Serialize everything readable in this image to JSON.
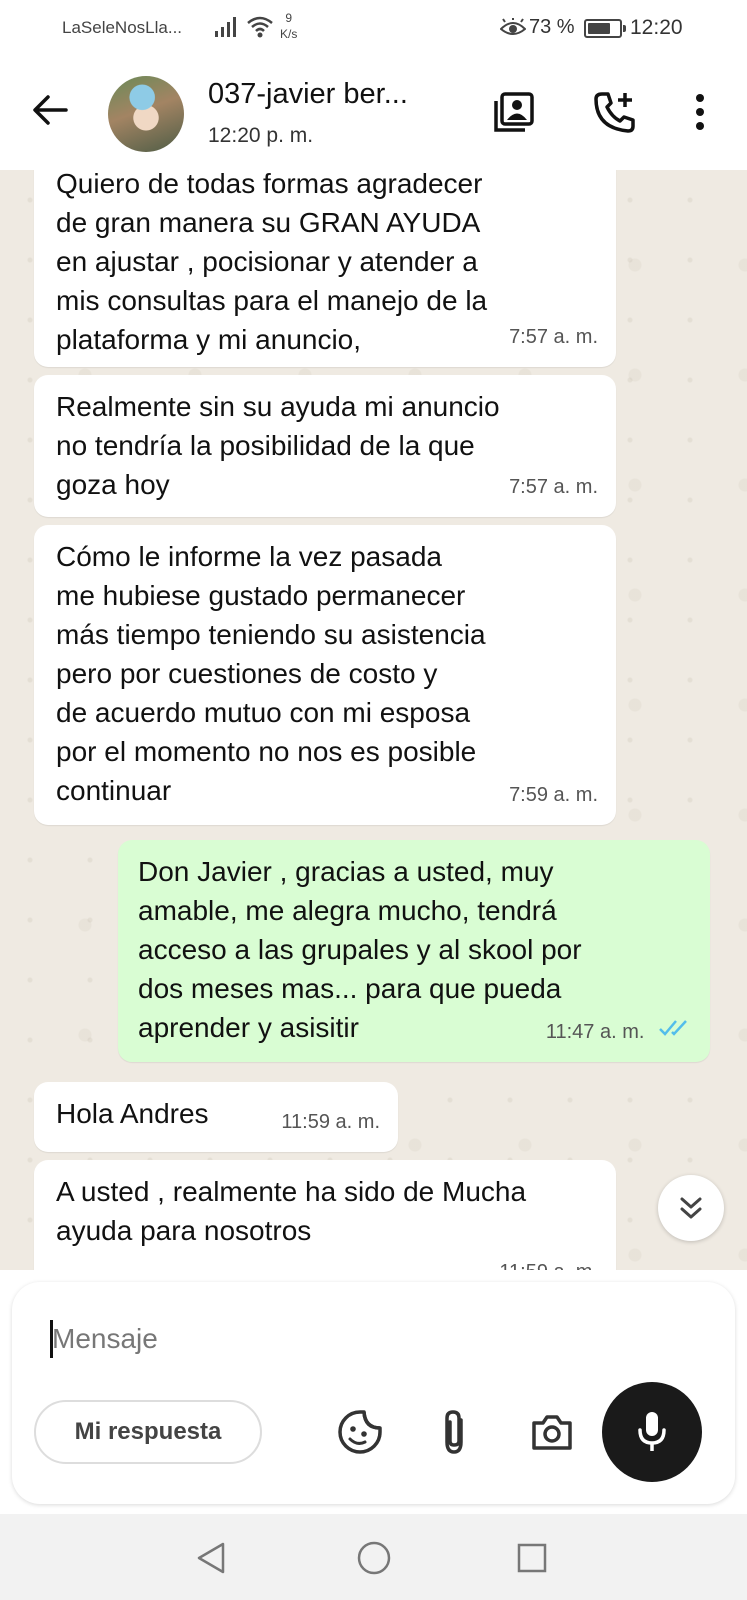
{
  "status_bar": {
    "carrier": "LaSeleNosLla...",
    "speed_value": "9",
    "speed_unit": "K/s",
    "battery_percent": "73 %",
    "battery_level": 0.73,
    "time": "12:20",
    "icons": [
      "signal-icon",
      "wifi-icon",
      "eye-comfort-icon",
      "battery-icon"
    ]
  },
  "header": {
    "title": "037-javier ber...",
    "subtitle": "12:20 p. m.",
    "icons": [
      "back-arrow-icon",
      "contact-card-icon",
      "add-call-icon",
      "more-vert-icon"
    ]
  },
  "messages": [
    {
      "direction": "in",
      "text": "Quiero de todas formas agradecer\nde gran manera  su GRAN AYUDA\nen ajustar , pocisionar y atender a\nmis consultas para el manejo de la\nplataforma y mi anuncio,",
      "time": "7:57 a. m."
    },
    {
      "direction": "in",
      "text": "Realmente sin su ayuda mi anuncio\nno tendría la posibilidad de la que\ngoza hoy",
      "time": "7:57 a. m."
    },
    {
      "direction": "in",
      "text": "Cómo le informe la vez pasada\nme hubiese gustado permanecer\nmás tiempo teniendo su asistencia\npero por cuestiones de costo y\nde acuerdo mutuo con mi esposa\npor el momento no nos es posible\ncontinuar",
      "time": "7:59 a. m."
    },
    {
      "direction": "out",
      "text": "Don Javier , gracias a usted, muy\namable, me alegra mucho, tendrá\nacceso a las grupales y al skool por\ndos meses mas... para que pueda\naprender y asisitir",
      "time": "11:47 a. m.",
      "status": "read"
    },
    {
      "direction": "in",
      "text": "Hola Andres",
      "time": "11:59 a. m."
    },
    {
      "direction": "in",
      "text": "A usted , realmente ha sido de Mucha\nayuda para nosotros",
      "time": "11:59 a. m."
    }
  ],
  "input": {
    "placeholder": "Mensaje",
    "quick_reply": "Mi respuesta",
    "icons": [
      "sticker-icon",
      "attach-icon",
      "camera-icon",
      "mic-icon",
      "scroll-down-icon"
    ]
  },
  "nav_bar": {
    "icons": [
      "nav-back-icon",
      "nav-home-icon",
      "nav-recents-icon"
    ]
  },
  "colors": {
    "incoming_bubble": "#ffffff",
    "outgoing_bubble": "#d9fdd3",
    "chat_background": "#efeae2",
    "read_ticks": "#53bdeb",
    "mic_button": "#1a1a1a"
  }
}
